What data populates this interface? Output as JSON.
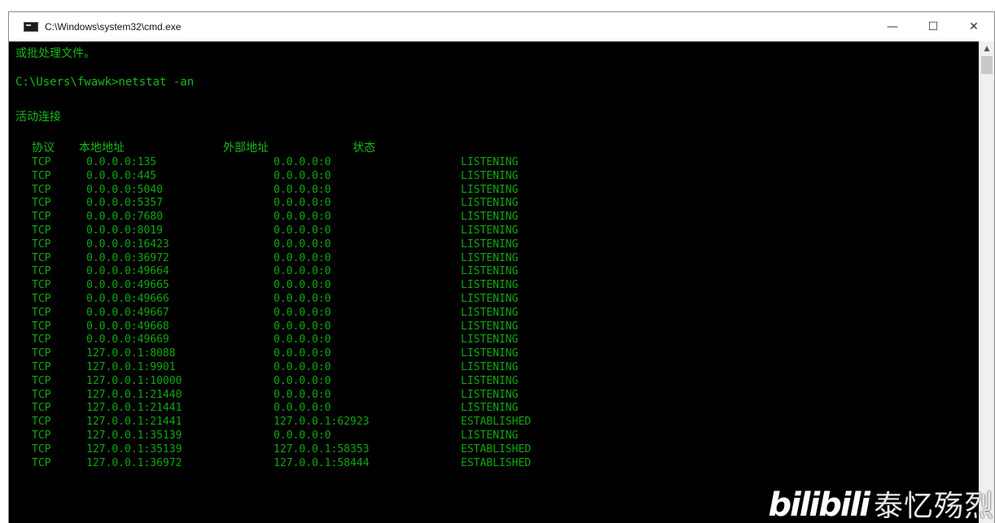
{
  "window": {
    "title": "C:\\Windows\\system32\\cmd.exe",
    "controls": {
      "minimize": "—",
      "maximize": "☐",
      "close": "✕"
    }
  },
  "console": {
    "line1": "或批处理文件。",
    "prompt": "C:\\Users\\fwawk>netstat -an",
    "section_title": "活动连接",
    "headers": {
      "proto": "协议",
      "local": "本地地址",
      "foreign": "外部地址",
      "state": "状态"
    },
    "rows": [
      {
        "proto": "TCP",
        "local": "0.0.0.0:135",
        "foreign": "0.0.0.0:0",
        "state": "LISTENING"
      },
      {
        "proto": "TCP",
        "local": "0.0.0.0:445",
        "foreign": "0.0.0.0:0",
        "state": "LISTENING"
      },
      {
        "proto": "TCP",
        "local": "0.0.0.0:5040",
        "foreign": "0.0.0.0:0",
        "state": "LISTENING"
      },
      {
        "proto": "TCP",
        "local": "0.0.0.0:5357",
        "foreign": "0.0.0.0:0",
        "state": "LISTENING"
      },
      {
        "proto": "TCP",
        "local": "0.0.0.0:7680",
        "foreign": "0.0.0.0:0",
        "state": "LISTENING"
      },
      {
        "proto": "TCP",
        "local": "0.0.0.0:8019",
        "foreign": "0.0.0.0:0",
        "state": "LISTENING"
      },
      {
        "proto": "TCP",
        "local": "0.0.0.0:16423",
        "foreign": "0.0.0.0:0",
        "state": "LISTENING"
      },
      {
        "proto": "TCP",
        "local": "0.0.0.0:36972",
        "foreign": "0.0.0.0:0",
        "state": "LISTENING"
      },
      {
        "proto": "TCP",
        "local": "0.0.0.0:49664",
        "foreign": "0.0.0.0:0",
        "state": "LISTENING"
      },
      {
        "proto": "TCP",
        "local": "0.0.0.0:49665",
        "foreign": "0.0.0.0:0",
        "state": "LISTENING"
      },
      {
        "proto": "TCP",
        "local": "0.0.0.0:49666",
        "foreign": "0.0.0.0:0",
        "state": "LISTENING"
      },
      {
        "proto": "TCP",
        "local": "0.0.0.0:49667",
        "foreign": "0.0.0.0:0",
        "state": "LISTENING"
      },
      {
        "proto": "TCP",
        "local": "0.0.0.0:49668",
        "foreign": "0.0.0.0:0",
        "state": "LISTENING"
      },
      {
        "proto": "TCP",
        "local": "0.0.0.0:49669",
        "foreign": "0.0.0.0:0",
        "state": "LISTENING"
      },
      {
        "proto": "TCP",
        "local": "127.0.0.1:8088",
        "foreign": "0.0.0.0:0",
        "state": "LISTENING"
      },
      {
        "proto": "TCP",
        "local": "127.0.0.1:9901",
        "foreign": "0.0.0.0:0",
        "state": "LISTENING"
      },
      {
        "proto": "TCP",
        "local": "127.0.0.1:10000",
        "foreign": "0.0.0.0:0",
        "state": "LISTENING"
      },
      {
        "proto": "TCP",
        "local": "127.0.0.1:21440",
        "foreign": "0.0.0.0:0",
        "state": "LISTENING"
      },
      {
        "proto": "TCP",
        "local": "127.0.0.1:21441",
        "foreign": "0.0.0.0:0",
        "state": "LISTENING"
      },
      {
        "proto": "TCP",
        "local": "127.0.0.1:21441",
        "foreign": "127.0.0.1:62923",
        "state": "ESTABLISHED"
      },
      {
        "proto": "TCP",
        "local": "127.0.0.1:35139",
        "foreign": "0.0.0.0:0",
        "state": "LISTENING"
      },
      {
        "proto": "TCP",
        "local": "127.0.0.1:35139",
        "foreign": "127.0.0.1:58353",
        "state": "ESTABLISHED"
      },
      {
        "proto": "TCP",
        "local": "127.0.0.1:36972",
        "foreign": "127.0.0.1:58444",
        "state": "ESTABLISHED"
      }
    ]
  },
  "watermark": {
    "logo": "bilibili",
    "author": "泰忆殇烈"
  },
  "colors": {
    "console_bg": "#000000",
    "console_text": "#19b819"
  }
}
